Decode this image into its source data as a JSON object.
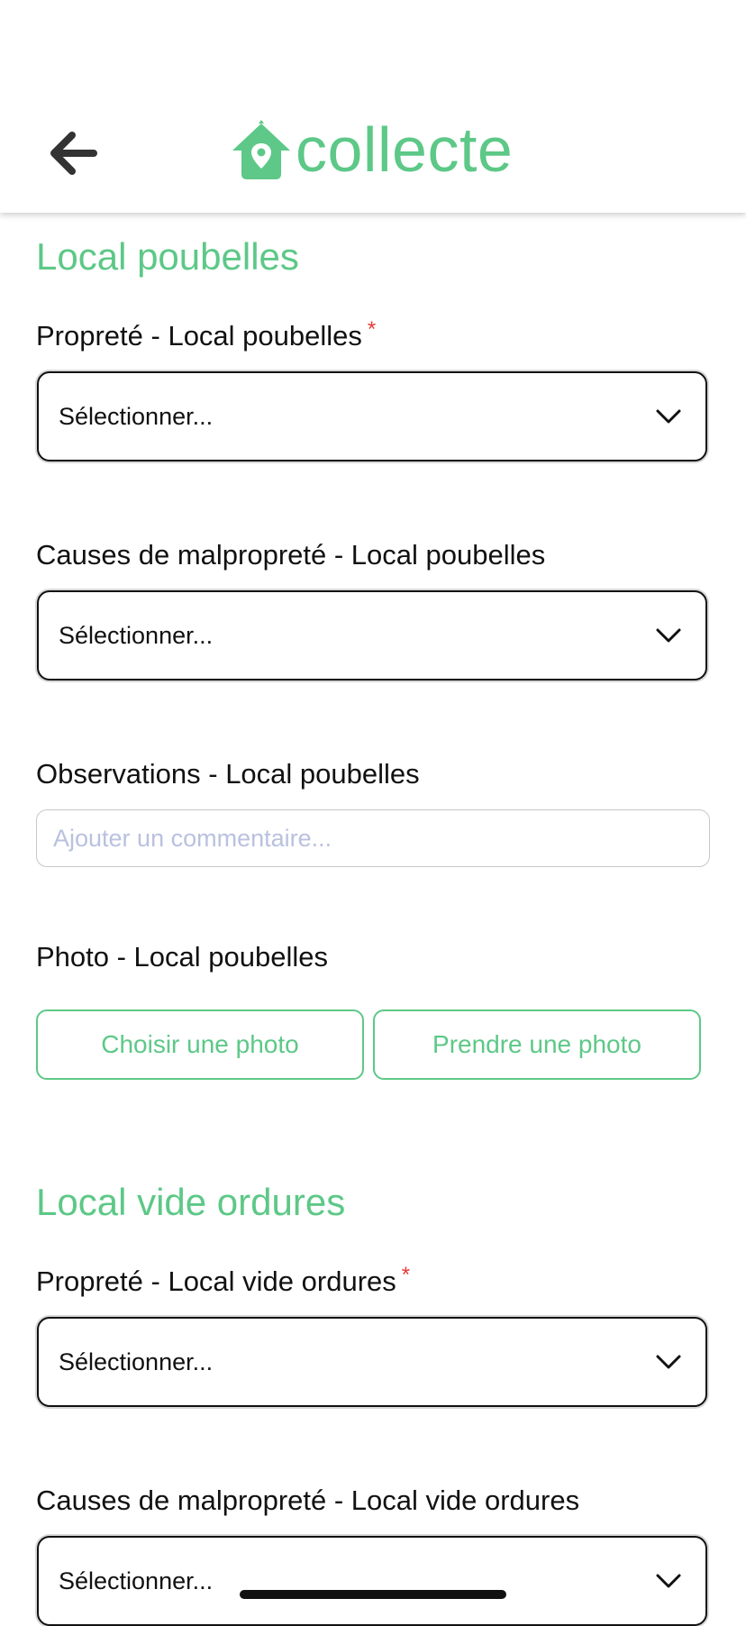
{
  "header": {
    "back_icon": "arrow-left-icon",
    "logo_icon": "house-location-pin-icon",
    "logo_text": "collecte",
    "accent_color": "#5dc887"
  },
  "sections": [
    {
      "title": "Local poubelles",
      "proprete": {
        "label": "Propreté - Local poubelles",
        "required_mark": "*",
        "select_value": "Sélectionner..."
      },
      "causes": {
        "label": "Causes de malpropreté - Local poubelles",
        "select_value": "Sélectionner..."
      },
      "observations": {
        "label": "Observations - Local poubelles",
        "placeholder": "Ajouter un commentaire..."
      },
      "photo": {
        "label": "Photo - Local poubelles",
        "choose_label": "Choisir une photo",
        "take_label": "Prendre une photo"
      }
    },
    {
      "title": "Local vide ordures",
      "proprete": {
        "label": "Propreté - Local vide ordures",
        "required_mark": "*",
        "select_value": "Sélectionner..."
      },
      "causes": {
        "label": "Causes de malpropreté - Local vide ordures",
        "select_value": "Sélectionner..."
      }
    }
  ]
}
